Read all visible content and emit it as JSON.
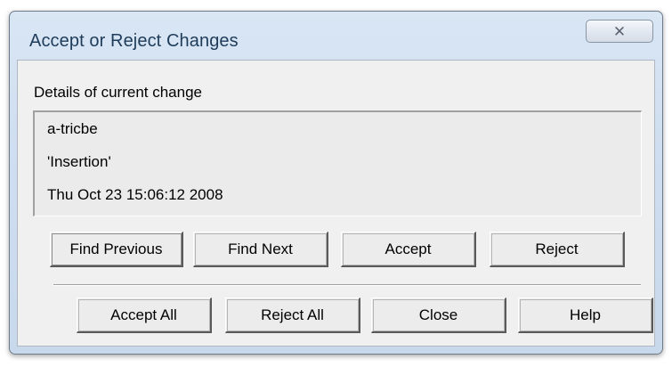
{
  "window": {
    "title": "Accept or Reject Changes",
    "close_glyph": "☒",
    "close_icon": "close-icon"
  },
  "details": {
    "label": "Details of current change",
    "author": "a-tricbe",
    "change_type": "'Insertion'",
    "timestamp": "Thu Oct 23 15:06:12 2008"
  },
  "buttons_row1": {
    "find_previous": "Find Previous",
    "find_next": "Find Next",
    "accept": "Accept",
    "reject": "Reject"
  },
  "buttons_row2": {
    "accept_all": "Accept All",
    "reject_all": "Reject All",
    "close": "Close",
    "help": "Help"
  },
  "colors": {
    "title_text": "#1e3c5a",
    "frame": "#d9e6f4",
    "client_bg": "#f0f0f0"
  }
}
